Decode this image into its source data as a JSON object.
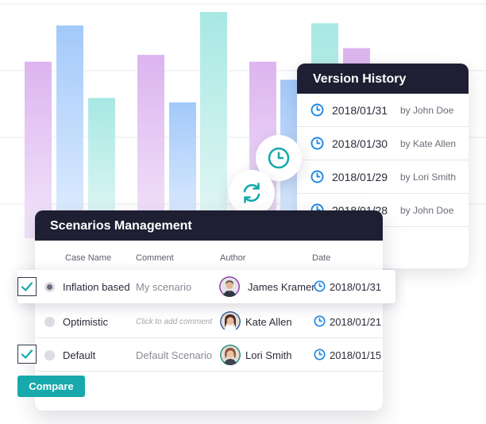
{
  "colors": {
    "header_bg": "#1f1f33",
    "accent_teal": "#17a9ac",
    "clock_blue": "#1e88e5",
    "bar_purple": "#dfb9f0",
    "bar_blue": "#a9cdfa",
    "bar_teal": "#aeeae6"
  },
  "chart_data": {
    "type": "bar",
    "series": [
      {
        "values": [
          78,
          84
        ]
      },
      {
        "values": [
          94,
          70
        ]
      },
      {
        "values": [
          62
        ]
      },
      {
        "values": [
          81,
          78
        ]
      },
      {
        "values": [
          60
        ]
      },
      {
        "values": [
          100
        ]
      },
      {
        "values": [
          95
        ]
      }
    ]
  },
  "version_history": {
    "title": "Version History",
    "items": [
      {
        "date": "2018/01/31",
        "by": "by John Doe"
      },
      {
        "date": "2018/01/30",
        "by": "by Kate Allen"
      },
      {
        "date": "2018/01/29",
        "by": "by Lori Smith"
      },
      {
        "date": "2018/01/28",
        "by": "by John Doe"
      }
    ]
  },
  "scenarios": {
    "title": "Scenarios Management",
    "columns": {
      "case_name": "Case Name",
      "comment": "Comment",
      "author": "Author",
      "date": "Date"
    },
    "rows": [
      {
        "case_name": "Inflation based",
        "comment": "My scenario",
        "author": "James Kramer",
        "date": "2018/01/31",
        "checked": true,
        "selected": true
      },
      {
        "case_name": "Optimistic",
        "comment": "Click to add comment",
        "author": "Kate Allen",
        "date": "2018/01/21",
        "checked": false,
        "selected": false
      },
      {
        "case_name": "Default",
        "comment": "Default Scenario",
        "author": "Lori Smith",
        "date": "2018/01/15",
        "checked": true,
        "selected": false
      }
    ]
  },
  "actions": {
    "compare_label": "Compare"
  },
  "icons": {
    "clock": "clock-icon",
    "sync": "sync-icon",
    "check": "check-icon",
    "avatar": "user-avatar-icon"
  }
}
